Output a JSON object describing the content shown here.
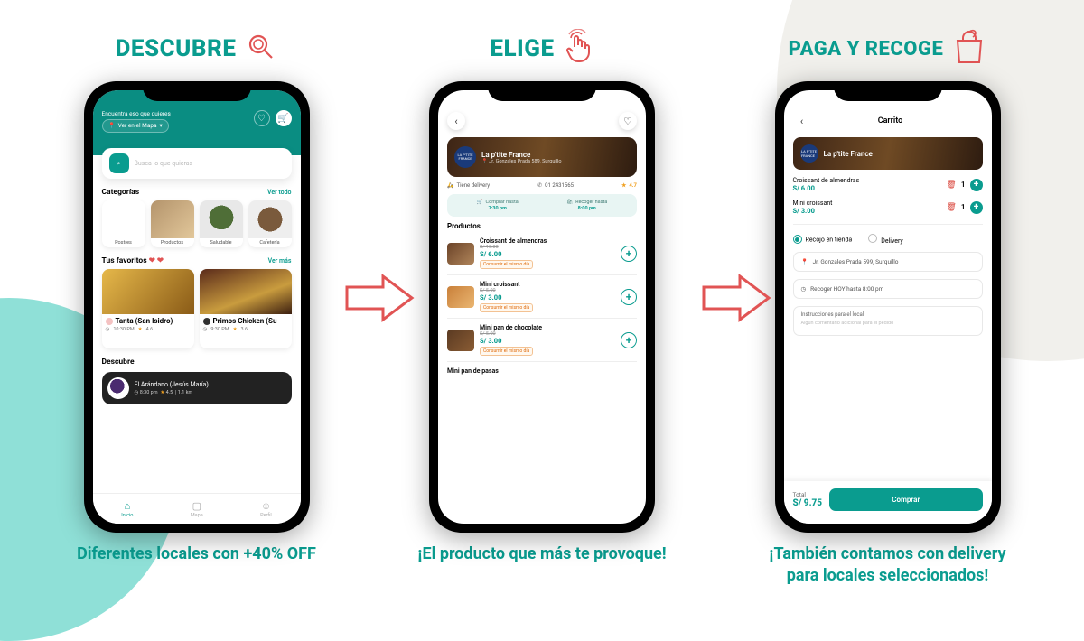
{
  "steps": {
    "discover": {
      "title": "DESCUBRE",
      "caption": "Diferentes locales con +40% OFF"
    },
    "choose": {
      "title": "ELIGE",
      "caption": "¡El producto que más te provoque!"
    },
    "pay": {
      "title": "PAGA Y RECOGE",
      "caption": "¡También contamos con delivery para locales seleccionados!"
    }
  },
  "phone1": {
    "header": {
      "subtitle": "Encuentra eso que quieres",
      "map_button": "Ver en el Mapa"
    },
    "search_placeholder": "Busca lo que quieras",
    "categories": {
      "title": "Categorías",
      "see_all": "Ver todo",
      "items": [
        "Postres",
        "Productos",
        "Saludable",
        "Cafetería"
      ]
    },
    "favorites": {
      "title": "Tus favoritos",
      "see_more": "Ver más",
      "items": [
        {
          "name": "Tanta (San Isidro)",
          "time": "10:30 PM",
          "rating": "4.6"
        },
        {
          "name": "Primos Chicken (Su",
          "time": "9:30 PM",
          "rating": "3.6"
        }
      ]
    },
    "discover": {
      "title": "Descubre",
      "item": {
        "name": "El Arándano (Jesús María)",
        "time": "8:30 pm",
        "rating": "4.5",
        "distance": "1.1 km"
      }
    },
    "nav": {
      "home": "Inicio",
      "map": "Mapa",
      "profile": "Perfil"
    }
  },
  "phone2": {
    "store": {
      "name": "La p'tite France",
      "address": "Jr. Gonzales Prada 589, Surquillo",
      "delivery_label": "Tiene delivery",
      "phone": "01 2431565",
      "rating": "4.7"
    },
    "schedule": {
      "buy_label": "Comprar hasta",
      "buy_time": "7:30 pm",
      "pickup_label": "Recoger hasta",
      "pickup_time": "8:00 pm"
    },
    "products_title": "Productos",
    "consume_tag": "Consumir el mismo día",
    "products": [
      {
        "name": "Croissant de almendras",
        "old": "S/ 10.00",
        "price": "S/ 6.00"
      },
      {
        "name": "Mini croissant",
        "old": "S/ 5.00",
        "price": "S/ 3.00"
      },
      {
        "name": "Mini pan de chocolate",
        "old": "S/ 5.00",
        "price": "S/ 3.00"
      },
      {
        "name": "Mini pan de pasas",
        "old": "",
        "price": ""
      }
    ]
  },
  "phone3": {
    "title": "Carrito",
    "store_name": "La p'tite France",
    "items": [
      {
        "name": "Croissant de almendras",
        "price": "S/ 6.00",
        "qty": "1"
      },
      {
        "name": "Mini croissant",
        "price": "S/ 3.00",
        "qty": "1"
      }
    ],
    "delivery": {
      "pickup": "Recojo en tienda",
      "delivery": "Delivery"
    },
    "address": "Jr. Gonzales Prada 599, Surquillo",
    "pickup_info": "Recoger HOY hasta 8:00 pm",
    "instructions": {
      "label": "Instrucciones para el local",
      "placeholder": "Algún comentario adicional para el pedido"
    },
    "total_label": "Total",
    "total_value": "S/ 9.75",
    "buy_button": "Comprar"
  }
}
